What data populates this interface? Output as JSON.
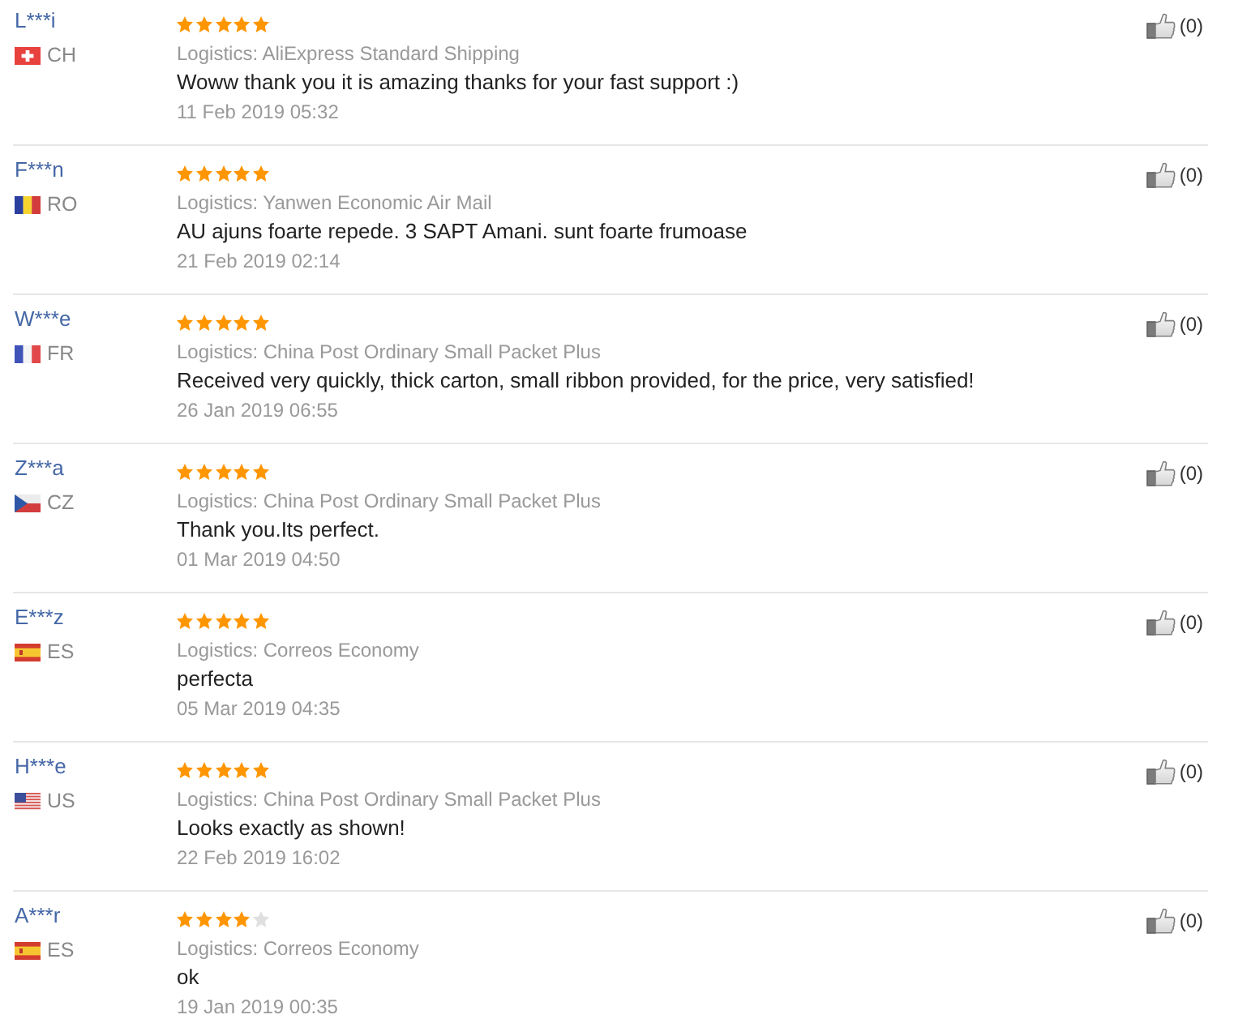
{
  "reviews": [
    {
      "user": "L***i",
      "flag": {
        "kind": "ch"
      },
      "country": "CH",
      "stars": 5,
      "logistics": "Logistics: AliExpress Standard Shipping",
      "comment": "Woww thank you it is amazing thanks for your fast support :)",
      "date": "11 Feb 2019 05:32",
      "likes": "(0)"
    },
    {
      "user": "F***n",
      "flag": {
        "kind": "ro"
      },
      "country": "RO",
      "stars": 5,
      "logistics": "Logistics: Yanwen Economic Air Mail",
      "comment": "AU ajuns foarte repede. 3 SAPT Amani. sunt foarte frumoase",
      "date": "21 Feb 2019 02:14",
      "likes": "(0)"
    },
    {
      "user": "W***e",
      "flag": {
        "kind": "fr"
      },
      "country": "FR",
      "stars": 5,
      "logistics": "Logistics: China Post Ordinary Small Packet Plus",
      "comment": "Received very quickly, thick carton, small ribbon provided, for the price, very satisfied!",
      "date": "26 Jan 2019 06:55",
      "likes": "(0)"
    },
    {
      "user": "Z***a",
      "flag": {
        "kind": "cz"
      },
      "country": "CZ",
      "stars": 5,
      "logistics": "Logistics: China Post Ordinary Small Packet Plus",
      "comment": "Thank you.Its perfect.",
      "date": "01 Mar 2019 04:50",
      "likes": "(0)"
    },
    {
      "user": "E***z",
      "flag": {
        "kind": "es"
      },
      "country": "ES",
      "stars": 5,
      "logistics": "Logistics: Correos Economy",
      "comment": "perfecta",
      "date": "05 Mar 2019 04:35",
      "likes": "(0)"
    },
    {
      "user": "H***e",
      "flag": {
        "kind": "us"
      },
      "country": "US",
      "stars": 5,
      "logistics": "Logistics: China Post Ordinary Small Packet Plus",
      "comment": "Looks exactly as shown!",
      "date": "22 Feb 2019 16:02",
      "likes": "(0)"
    },
    {
      "user": "A***r",
      "flag": {
        "kind": "es"
      },
      "country": "ES",
      "stars": 4,
      "logistics": "Logistics: Correos Economy",
      "comment": "ok",
      "date": "19 Jan 2019 00:35",
      "likes": "(0)"
    }
  ]
}
